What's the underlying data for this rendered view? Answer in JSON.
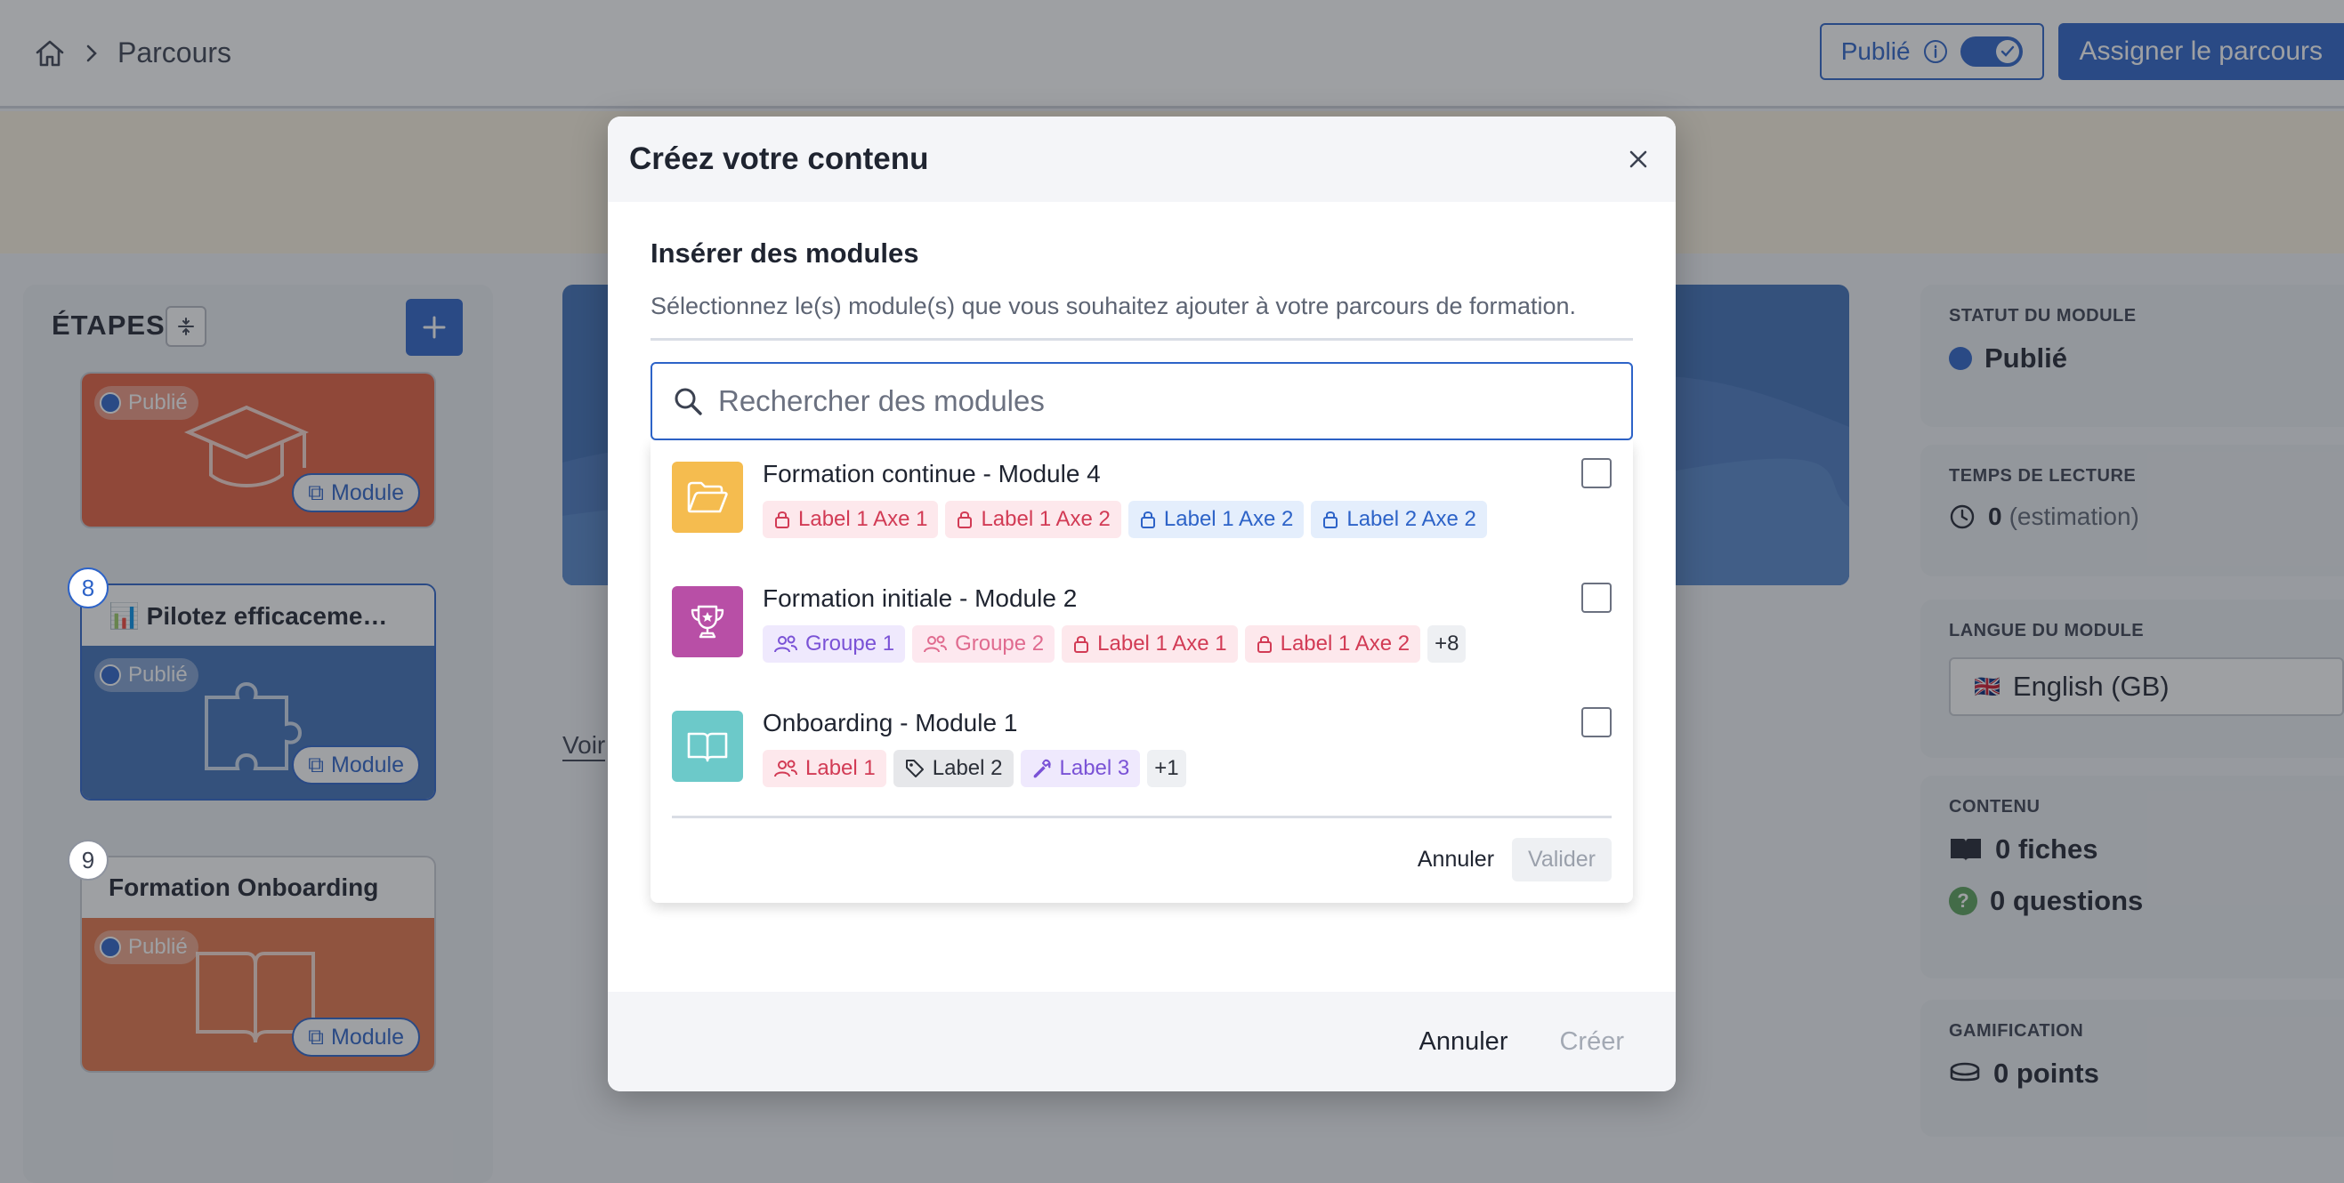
{
  "breadcrumb": {
    "current": "Parcours"
  },
  "top_actions": {
    "published_label": "Publié",
    "assign_label": "Assigner le parcours"
  },
  "steps": {
    "title": "ÉTAPES",
    "cards": [
      {
        "number": "",
        "title": "",
        "status": "Publié",
        "type": "Module",
        "icon": "graduation-cap-icon",
        "color": "#e5603f"
      },
      {
        "number": "8",
        "title": "📊 Pilotez efficaceme…",
        "status": "Publié",
        "type": "Module",
        "icon": "puzzle-icon",
        "color": "#3f6fb9"
      },
      {
        "number": "9",
        "title": "Formation Onboarding",
        "status": "Publié",
        "type": "Module",
        "icon": "book-icon",
        "color": "#e5764a"
      }
    ]
  },
  "main": {
    "voir_label": "Voir"
  },
  "side": {
    "status": {
      "label": "STATUT DU MODULE",
      "value": "Publié"
    },
    "reading": {
      "label": "TEMPS DE LECTURE",
      "value": "0",
      "unit": "(estimation)"
    },
    "language": {
      "label": "LANGUE DU MODULE",
      "flag": "🇬🇧",
      "value": "English (GB)"
    },
    "content": {
      "label": "CONTENU",
      "sheets": "0 fiches",
      "questions": "0 questions"
    },
    "gamification": {
      "label": "GAMIFICATION",
      "points": "0 points"
    }
  },
  "modal": {
    "title": "Créez votre contenu",
    "section_title": "Insérer des modules",
    "description": "Sélectionnez le(s) module(s) que vous souhaitez ajouter à votre parcours de formation.",
    "search": {
      "placeholder": "Rechercher des modules",
      "value": ""
    },
    "results": [
      {
        "title": "Formation continue - Module 4",
        "icon": "folder-open-icon",
        "color": "#f5bc4f",
        "checked": false,
        "tags": [
          {
            "label": "Label 1 Axe 1",
            "style": "red",
            "icon": "lock-icon"
          },
          {
            "label": "Label 1 Axe 2",
            "style": "red",
            "icon": "lock-icon"
          },
          {
            "label": "Label 1 Axe 2",
            "style": "blue",
            "icon": "lock-icon"
          },
          {
            "label": "Label 2 Axe 2",
            "style": "blue",
            "icon": "lock-icon"
          }
        ]
      },
      {
        "title": "Formation initiale - Module 2",
        "icon": "trophy-icon",
        "color": "#b84fa6",
        "checked": false,
        "tags": [
          {
            "label": "Groupe 1",
            "style": "purple",
            "icon": "users-icon"
          },
          {
            "label": "Groupe 2",
            "style": "pink",
            "icon": "users-icon"
          },
          {
            "label": "Label 1 Axe 1",
            "style": "red",
            "icon": "lock-icon"
          },
          {
            "label": "Label 1 Axe 2",
            "style": "red",
            "icon": "lock-icon"
          }
        ],
        "more": "+8"
      },
      {
        "title": "Onboarding - Module 1",
        "icon": "open-book-icon",
        "color": "#6cc9c9",
        "checked": false,
        "tags": [
          {
            "label": "Label 1",
            "style": "red",
            "icon": "users-icon"
          },
          {
            "label": "Label 2",
            "style": "grey",
            "icon": "tag-icon"
          },
          {
            "label": "Label 3",
            "style": "purple",
            "icon": "wrench-icon"
          }
        ],
        "more": "+1"
      }
    ],
    "results_cancel": "Annuler",
    "results_validate": "Valider",
    "footer_cancel": "Annuler",
    "footer_create": "Créer"
  }
}
